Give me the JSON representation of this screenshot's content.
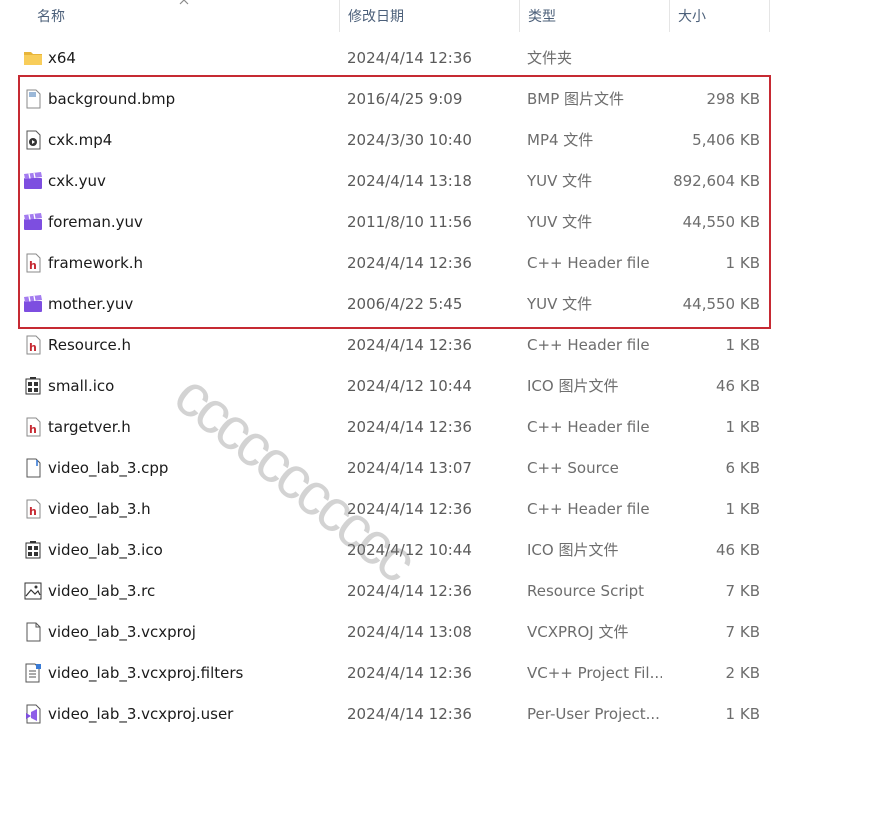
{
  "columns": {
    "name": "名称",
    "date": "修改日期",
    "type": "类型",
    "size": "大小"
  },
  "files": [
    {
      "name": "x64",
      "date": "2024/4/14 12:36",
      "type": "文件夹",
      "size": "",
      "icon": "folder"
    },
    {
      "name": "background.bmp",
      "date": "2016/4/25 9:09",
      "type": "BMP 图片文件",
      "size": "298 KB",
      "icon": "image"
    },
    {
      "name": "cxk.mp4",
      "date": "2024/3/30 10:40",
      "type": "MP4 文件",
      "size": "5,406 KB",
      "icon": "video"
    },
    {
      "name": "cxk.yuv",
      "date": "2024/4/14 13:18",
      "type": "YUV 文件",
      "size": "892,604 KB",
      "icon": "clapper"
    },
    {
      "name": "foreman.yuv",
      "date": "2011/8/10 11:56",
      "type": "YUV 文件",
      "size": "44,550 KB",
      "icon": "clapper"
    },
    {
      "name": "framework.h",
      "date": "2024/4/14 12:36",
      "type": "C++ Header file",
      "size": "1 KB",
      "icon": "header"
    },
    {
      "name": "mother.yuv",
      "date": "2006/4/22 5:45",
      "type": "YUV 文件",
      "size": "44,550 KB",
      "icon": "clapper"
    },
    {
      "name": "Resource.h",
      "date": "2024/4/14 12:36",
      "type": "C++ Header file",
      "size": "1 KB",
      "icon": "header"
    },
    {
      "name": "small.ico",
      "date": "2024/4/12 10:44",
      "type": "ICO 图片文件",
      "size": "46 KB",
      "icon": "ico"
    },
    {
      "name": "targetver.h",
      "date": "2024/4/14 12:36",
      "type": "C++ Header file",
      "size": "1 KB",
      "icon": "header"
    },
    {
      "name": "video_lab_3.cpp",
      "date": "2024/4/14 13:07",
      "type": "C++ Source",
      "size": "6 KB",
      "icon": "cpp"
    },
    {
      "name": "video_lab_3.h",
      "date": "2024/4/14 12:36",
      "type": "C++ Header file",
      "size": "1 KB",
      "icon": "header"
    },
    {
      "name": "video_lab_3.ico",
      "date": "2024/4/12 10:44",
      "type": "ICO 图片文件",
      "size": "46 KB",
      "icon": "ico"
    },
    {
      "name": "video_lab_3.rc",
      "date": "2024/4/14 12:36",
      "type": "Resource Script",
      "size": "7 KB",
      "icon": "rc"
    },
    {
      "name": "video_lab_3.vcxproj",
      "date": "2024/4/14 13:08",
      "type": "VCXPROJ 文件",
      "size": "7 KB",
      "icon": "blank"
    },
    {
      "name": "video_lab_3.vcxproj.filters",
      "date": "2024/4/14 12:36",
      "type": "VC++ Project Fil...",
      "size": "2 KB",
      "icon": "filters"
    },
    {
      "name": "video_lab_3.vcxproj.user",
      "date": "2024/4/14 12:36",
      "type": "Per-User Project...",
      "size": "1 KB",
      "icon": "vsuser"
    }
  ],
  "watermark": "ccccccccccc"
}
